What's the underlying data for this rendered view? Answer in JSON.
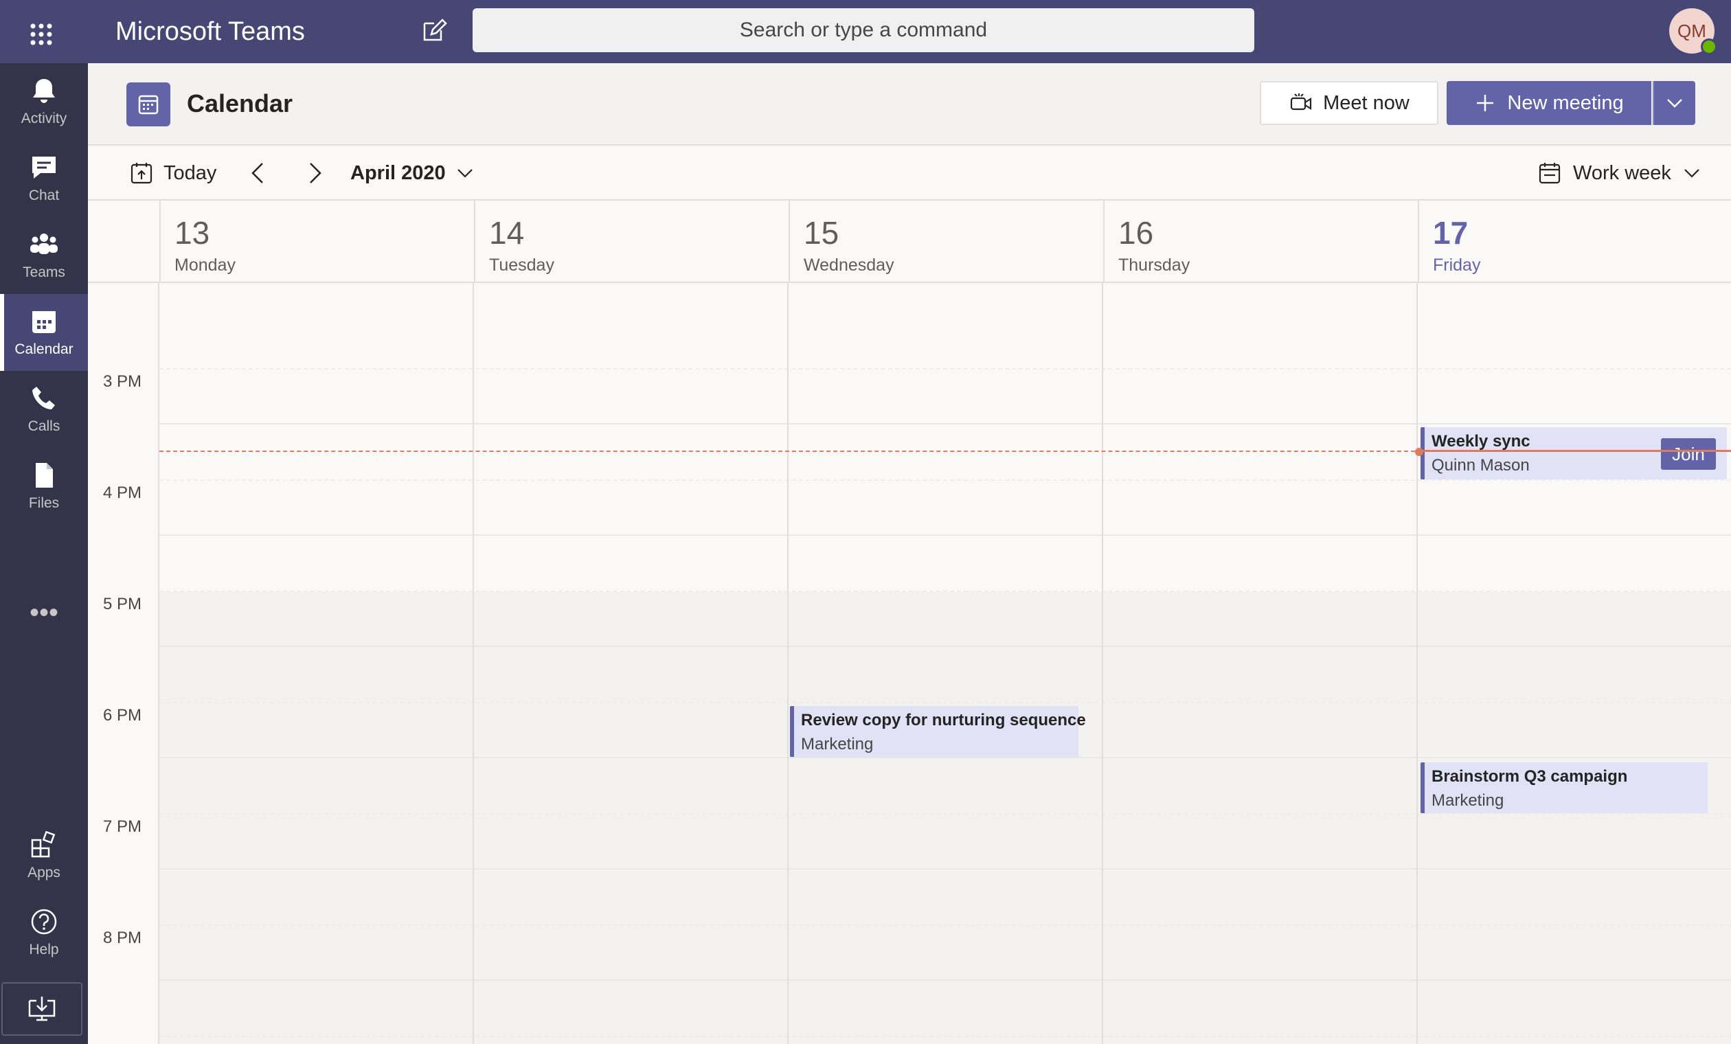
{
  "app": {
    "title": "Microsoft Teams",
    "search_placeholder": "Search or type a command",
    "avatar_initials": "QM"
  },
  "rail": {
    "items": [
      {
        "label": "Activity",
        "icon": "bell-icon"
      },
      {
        "label": "Chat",
        "icon": "chat-icon"
      },
      {
        "label": "Teams",
        "icon": "teams-icon"
      },
      {
        "label": "Calendar",
        "icon": "calendar-icon",
        "active": true
      },
      {
        "label": "Calls",
        "icon": "phone-icon"
      },
      {
        "label": "Files",
        "icon": "file-icon"
      }
    ],
    "more": "•••",
    "bottom_items": [
      {
        "label": "Apps",
        "icon": "apps-icon"
      },
      {
        "label": "Help",
        "icon": "help-icon"
      }
    ]
  },
  "header": {
    "title": "Calendar",
    "meet_now": "Meet now",
    "new_meeting": "New meeting"
  },
  "toolbar": {
    "today": "Today",
    "month": "April 2020",
    "view": "Work week"
  },
  "days": [
    {
      "num": "13",
      "name": "Monday"
    },
    {
      "num": "14",
      "name": "Tuesday"
    },
    {
      "num": "15",
      "name": "Wednesday"
    },
    {
      "num": "16",
      "name": "Thursday"
    },
    {
      "num": "17",
      "name": "Friday",
      "today": true
    }
  ],
  "times": [
    "3 PM",
    "4 PM",
    "5 PM",
    "6 PM",
    "7 PM",
    "8 PM"
  ],
  "events": [
    {
      "title": "Weekly sync",
      "subtitle": "Quinn Mason",
      "day": "17",
      "join": "Join"
    },
    {
      "title": "Review copy for nurturing sequence",
      "subtitle": "Marketing",
      "day": "15"
    },
    {
      "title": "Brainstorm Q3 campaign",
      "subtitle": "Marketing",
      "day": "17"
    }
  ],
  "colors": {
    "brand": "#6264a7",
    "topbar": "#464775",
    "rail": "#33344a",
    "now_indicator": "#e07a5f"
  }
}
